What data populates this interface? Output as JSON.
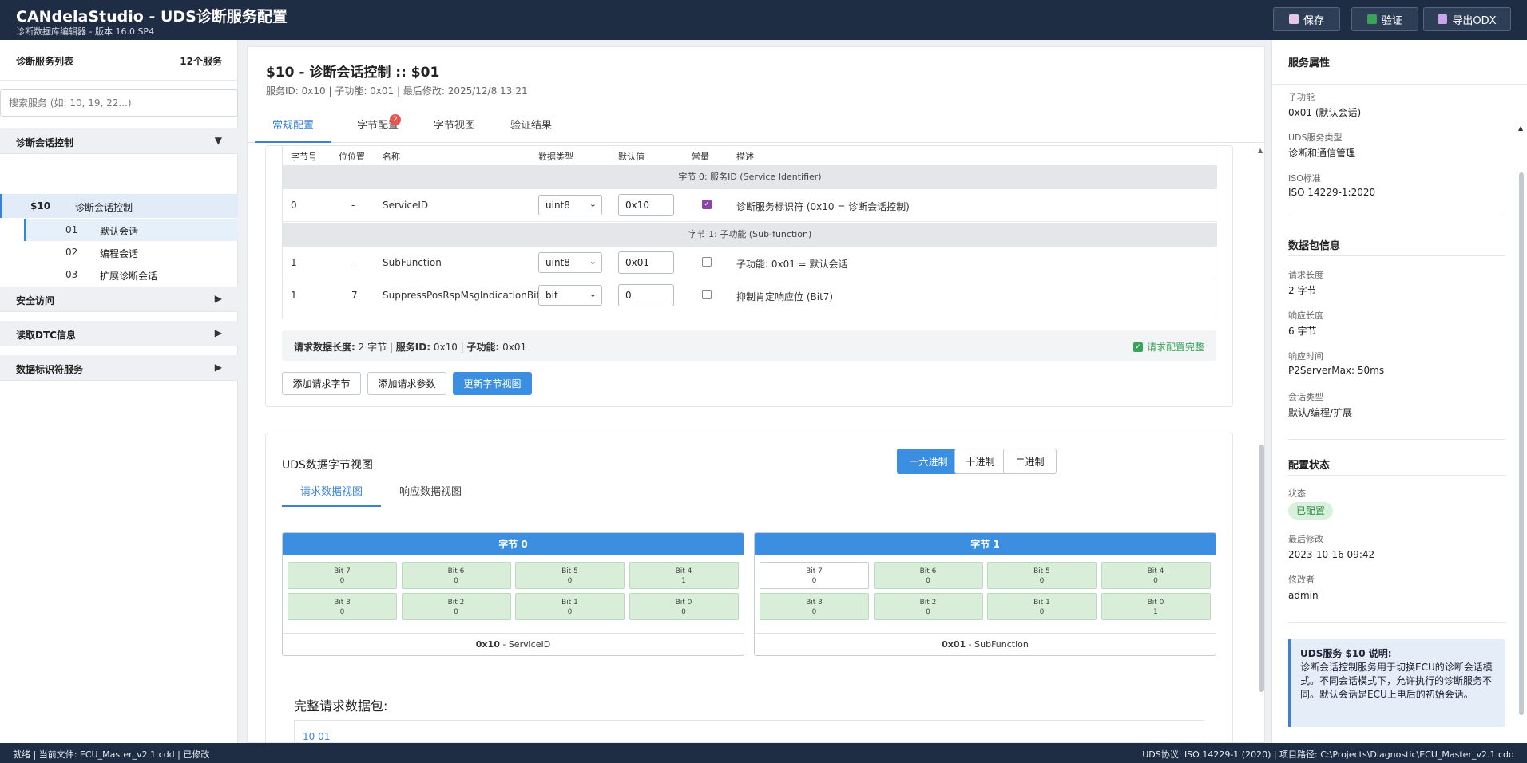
{
  "app": {
    "title": "CANdelaStudio - UDS诊断服务配置",
    "subtitle": "诊断数据库编辑器 - 版本 16.0 SP4",
    "buttons": {
      "save": "保存",
      "verify": "验证",
      "export": "导出ODX"
    }
  },
  "sidebar": {
    "title": "诊断服务列表",
    "count": "12个服务",
    "search_placeholder": "搜索服务 (如: 10, 19, 22...)",
    "groups": [
      {
        "label": "诊断会话控制",
        "arrow": "▼"
      },
      {
        "label": "安全访问",
        "arrow": "▶"
      },
      {
        "label": "读取DTC信息",
        "arrow": "▶"
      },
      {
        "label": "数据标识符服务",
        "arrow": "▶"
      }
    ],
    "service": {
      "id": "$10",
      "name": "诊断会话控制"
    },
    "subfunctions": [
      {
        "num": "01",
        "label": "默认会话"
      },
      {
        "num": "02",
        "label": "编程会话"
      },
      {
        "num": "03",
        "label": "扩展诊断会话"
      }
    ]
  },
  "main": {
    "title": "$10 - 诊断会话控制 :: $01",
    "meta": "服务ID: 0x10 | 子功能: 0x01 | 最后修改: 2025/12/8 13:21",
    "tabs": [
      "常规配置",
      "字节配置",
      "字节视图",
      "验证结果"
    ],
    "tab_badge": "2",
    "table": {
      "headers": [
        "字节号",
        "位位置",
        "名称",
        "数据类型",
        "默认值",
        "常量",
        "描述"
      ],
      "section0": "字节 0: 服务ID (Service Identifier)",
      "section1": "字节 1: 子功能 (Sub-function)",
      "rows": [
        {
          "byte": "0",
          "bit": "-",
          "name": "ServiceID",
          "type": "uint8",
          "value": "0x10",
          "desc": "诊断服务标识符 (0x10 = 诊断会话控制)"
        },
        {
          "byte": "1",
          "bit": "-",
          "name": "SubFunction",
          "type": "uint8",
          "value": "0x01",
          "desc": "子功能: 0x01 = 默认会话"
        },
        {
          "byte": "1",
          "bit": "7",
          "name": "SuppressPosRspMsgIndicationBit",
          "type": "bit",
          "value": "0",
          "desc": "抑制肯定响应位 (Bit7)"
        }
      ]
    },
    "summary": {
      "len_label": "请求数据长度:",
      "len_value": "2 字节",
      "sid_label": "服务ID:",
      "sid_value": "0x10",
      "sub_label": "子功能:",
      "sub_value": "0x01",
      "ok": "请求配置完整"
    },
    "actions": {
      "add_byte": "添加请求字节",
      "add_param": "添加请求参数",
      "update": "更新字节视图"
    },
    "byteview": {
      "title": "UDS数据字节视图",
      "formats": [
        "十六进制",
        "十进制",
        "二进制"
      ],
      "subtabs": [
        "请求数据视图",
        "响应数据视图"
      ],
      "bytes": [
        {
          "header": "字节 0",
          "hex": "0x10",
          "name": "ServiceID",
          "bits": [
            [
              "Bit 7",
              "0"
            ],
            [
              "Bit 6",
              "0"
            ],
            [
              "Bit 5",
              "0"
            ],
            [
              "Bit 4",
              "1"
            ],
            [
              "Bit 3",
              "0"
            ],
            [
              "Bit 2",
              "0"
            ],
            [
              "Bit 1",
              "0"
            ],
            [
              "Bit 0",
              "0"
            ]
          ]
        },
        {
          "header": "字节 1",
          "hex": "0x01",
          "name": "SubFunction",
          "bits": [
            [
              "Bit 7",
              "0"
            ],
            [
              "Bit 6",
              "0"
            ],
            [
              "Bit 5",
              "0"
            ],
            [
              "Bit 4",
              "0"
            ],
            [
              "Bit 3",
              "0"
            ],
            [
              "Bit 2",
              "0"
            ],
            [
              "Bit 1",
              "0"
            ],
            [
              "Bit 0",
              "1"
            ]
          ]
        }
      ],
      "packet_label": "完整请求数据包:",
      "packet_value": "10 01"
    }
  },
  "props": {
    "title": "服务属性",
    "sub_label": "子功能",
    "sub_value": "0x01 (默认会话)",
    "type_label": "UDS服务类型",
    "type_value": "诊断和通信管理",
    "iso_label": "ISO标准",
    "iso_value": "ISO 14229-1:2020",
    "pkt_title": "数据包信息",
    "req_label": "请求长度",
    "req_value": "2 字节",
    "rsp_label": "响应长度",
    "rsp_value": "6 字节",
    "time_label": "响应时间",
    "time_value": "P2ServerMax: 50ms",
    "sess_label": "会话类型",
    "sess_value": "默认/编程/扩展",
    "cfg_title": "配置状态",
    "state_label": "状态",
    "state_value": "已配置",
    "mod_label": "最后修改",
    "mod_value": "2023-10-16 09:42",
    "by_label": "修改者",
    "by_value": "admin",
    "info_title": "UDS服务 $10 说明:",
    "info_text": "诊断会话控制服务用于切换ECU的诊断会话模式。不同会话模式下，允许执行的诊断服务不同。默认会话是ECU上电后的初始会话。"
  },
  "statusbar": {
    "left": "就绪 | 当前文件: ECU_Master_v2.1.cdd | 已修改",
    "right": "UDS协议: ISO 14229-1 (2020) | 项目路径: C:\\Projects\\Diagnostic\\ECU_Master_v2.1.cdd"
  },
  "colors": {
    "accent": "#3b82d6",
    "header": "#1f2d44",
    "bit_set": "#d9eed9",
    "ok": "#3aa35a"
  }
}
